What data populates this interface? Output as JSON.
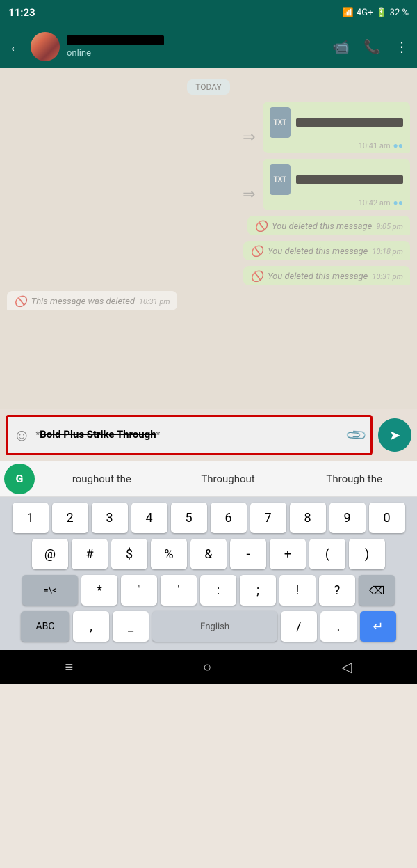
{
  "statusBar": {
    "time": "11:23",
    "signal": "4G+",
    "battery": "32 %"
  },
  "header": {
    "contactStatus": "online",
    "backLabel": "←",
    "videoCallIcon": "📹",
    "callIcon": "📞",
    "menuIcon": "⋮"
  },
  "dateDivider": "TODAY",
  "messages": [
    {
      "type": "file-out",
      "fileType": "TXT",
      "time": "10:41 am",
      "hasForward": true
    },
    {
      "type": "file-out",
      "fileType": "TXT",
      "time": "10:42 am",
      "hasForward": true
    },
    {
      "type": "deleted-out",
      "text": "You deleted this message",
      "time": "9:05 pm"
    },
    {
      "type": "deleted-out",
      "text": "You deleted this message",
      "time": "10:18 pm"
    },
    {
      "type": "deleted-out",
      "text": "You deleted this message",
      "time": "10:31 pm"
    },
    {
      "type": "deleted-in",
      "text": "This message was deleted",
      "time": "10:31 pm"
    }
  ],
  "inputBar": {
    "emojiIcon": "☺",
    "textPart1": "*",
    "textBold": "Bold Plus Strike Through",
    "textPart2": "*",
    "attachIcon": "📎",
    "sendIcon": "➤"
  },
  "autocomplete": {
    "grammarlyLabel": "G",
    "items": [
      "roughout the",
      "Throughout",
      "Through the"
    ]
  },
  "keyboard": {
    "row1": [
      "1",
      "2",
      "3",
      "4",
      "5",
      "6",
      "7",
      "8",
      "9",
      "0"
    ],
    "row2": [
      "@",
      "#",
      "$",
      "%",
      "&",
      "-",
      "+",
      "(",
      ")"
    ],
    "row3left": "=\\<",
    "row3mid": [
      "*",
      "\"",
      "'",
      ":",
      ";",
      "!",
      "?"
    ],
    "row3right": "⌫",
    "row4left": "ABC",
    "row4space": "English",
    "row4items": [
      ",",
      "_"
    ],
    "row4end": [
      "/",
      "."
    ],
    "row4enter": "↵"
  },
  "navBar": {
    "homeIcon": "≡",
    "circleIcon": "○",
    "backIcon": "◁"
  }
}
